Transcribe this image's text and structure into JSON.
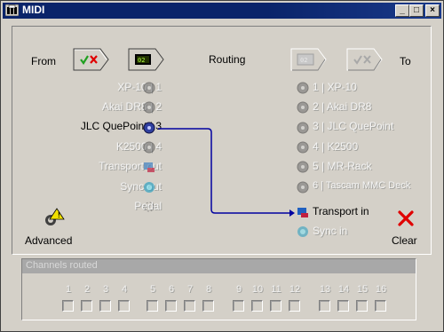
{
  "window": {
    "title": "MIDI"
  },
  "header": {
    "from_label": "From",
    "routing_label": "Routing",
    "to_label": "To",
    "from_device_code": "02",
    "to_device_code": "02"
  },
  "sources": [
    {
      "label": "XP-10 | 1",
      "active": false
    },
    {
      "label": "Akai DR8 | 2",
      "active": false
    },
    {
      "label": "JLC QuePoint | 3",
      "active": true
    },
    {
      "label": "K2500 | 4",
      "active": false
    },
    {
      "label": "Transport out",
      "active": false
    },
    {
      "label": "Sync out",
      "active": false
    },
    {
      "label": "Pedal",
      "active": false
    }
  ],
  "destinations": [
    {
      "label": "1 | XP-10",
      "active": false
    },
    {
      "label": "2 | Akai DR8",
      "active": false
    },
    {
      "label": "3 | JLC QuePoint",
      "active": false
    },
    {
      "label": "4 | K2500",
      "active": false
    },
    {
      "label": "5 | MR-Rack",
      "active": false
    },
    {
      "label": "6 | Tascam MMC Deck",
      "active": false
    },
    {
      "label": "Transport in",
      "active": true
    },
    {
      "label": "Sync in",
      "active": false
    }
  ],
  "actions": {
    "advanced_label": "Advanced",
    "clear_label": "Clear"
  },
  "channels": {
    "header": "Channels routed",
    "numbers": [
      "1",
      "2",
      "3",
      "4",
      "5",
      "6",
      "7",
      "8",
      "9",
      "10",
      "11",
      "12",
      "13",
      "14",
      "15",
      "16"
    ]
  },
  "colors": {
    "titlebar": "#0a246a",
    "route_line": "#0000a0",
    "clear_x": "#e00000",
    "check": "#20a020"
  }
}
